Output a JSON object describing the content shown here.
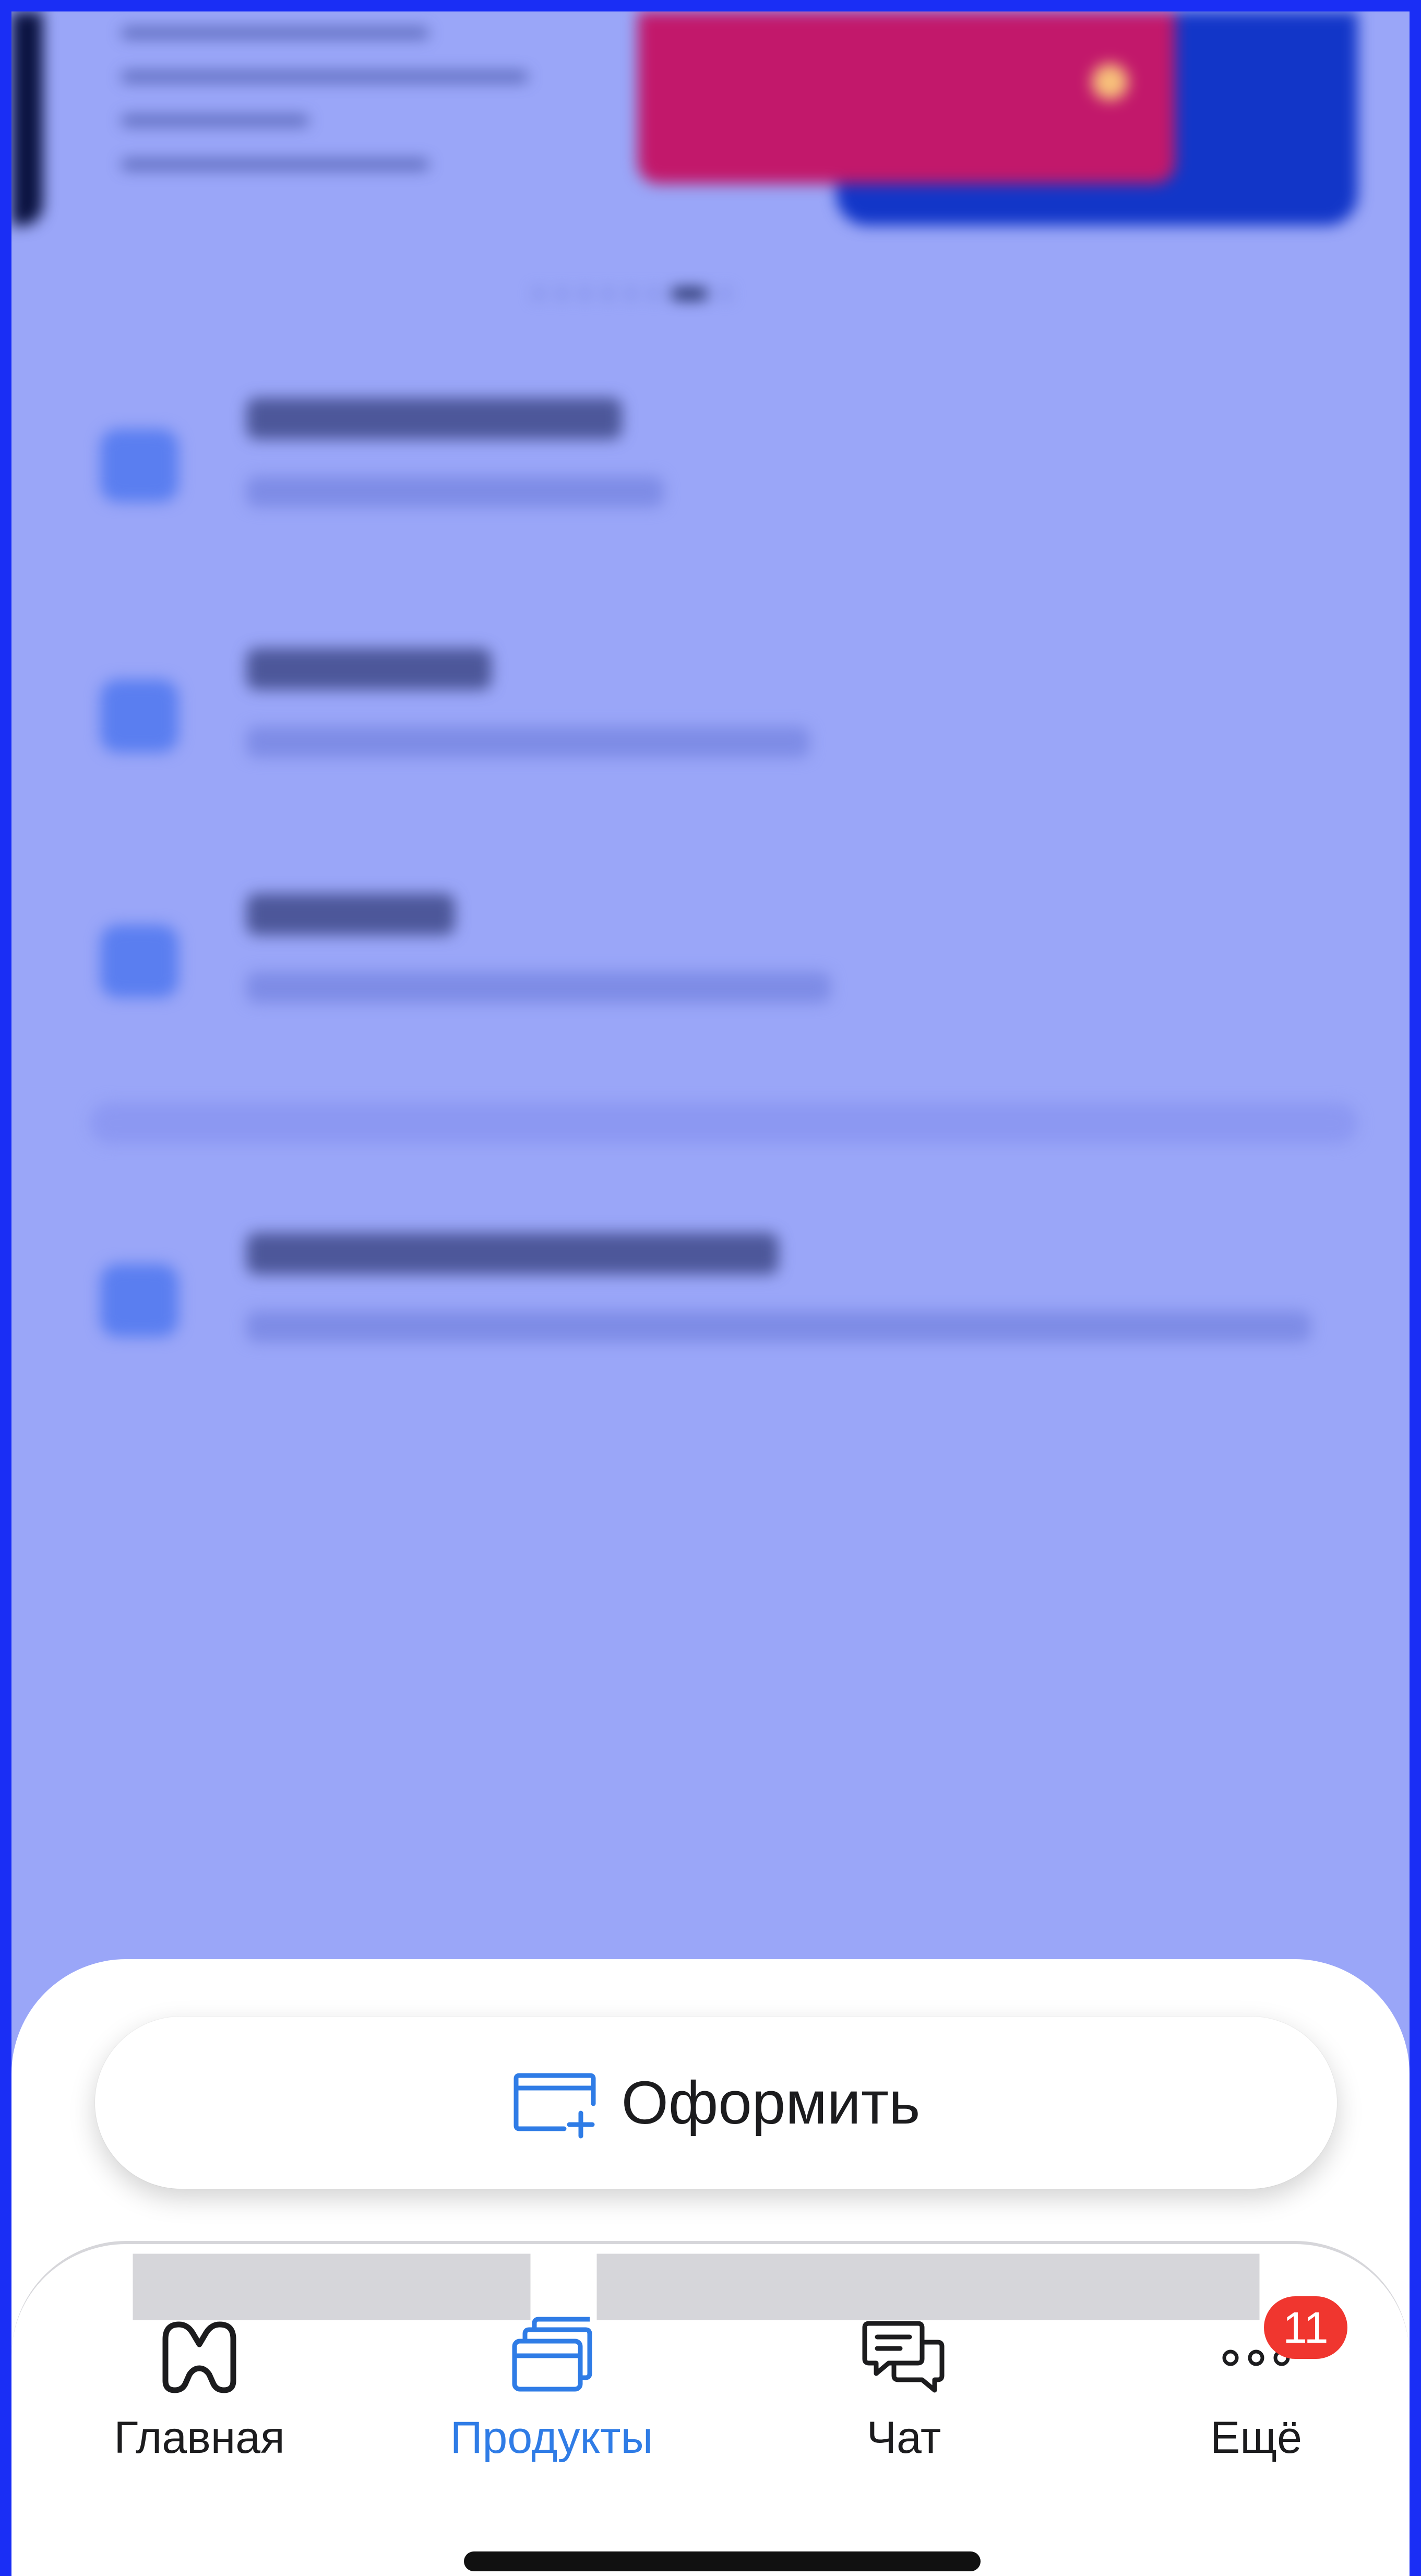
{
  "apply_button": {
    "label": "Оформить"
  },
  "tabs": [
    {
      "key": "home",
      "label": "Главная",
      "active": false
    },
    {
      "key": "products",
      "label": "Продукты",
      "active": true
    },
    {
      "key": "chat",
      "label": "Чат",
      "active": false
    },
    {
      "key": "more",
      "label": "Ещё",
      "active": false
    }
  ],
  "more_badge": {
    "count": "11"
  },
  "colors": {
    "accent": "#2f7ce6",
    "badge": "#f0362f",
    "overlay": "#9aa6f8",
    "frame": "#1a2ef5"
  }
}
